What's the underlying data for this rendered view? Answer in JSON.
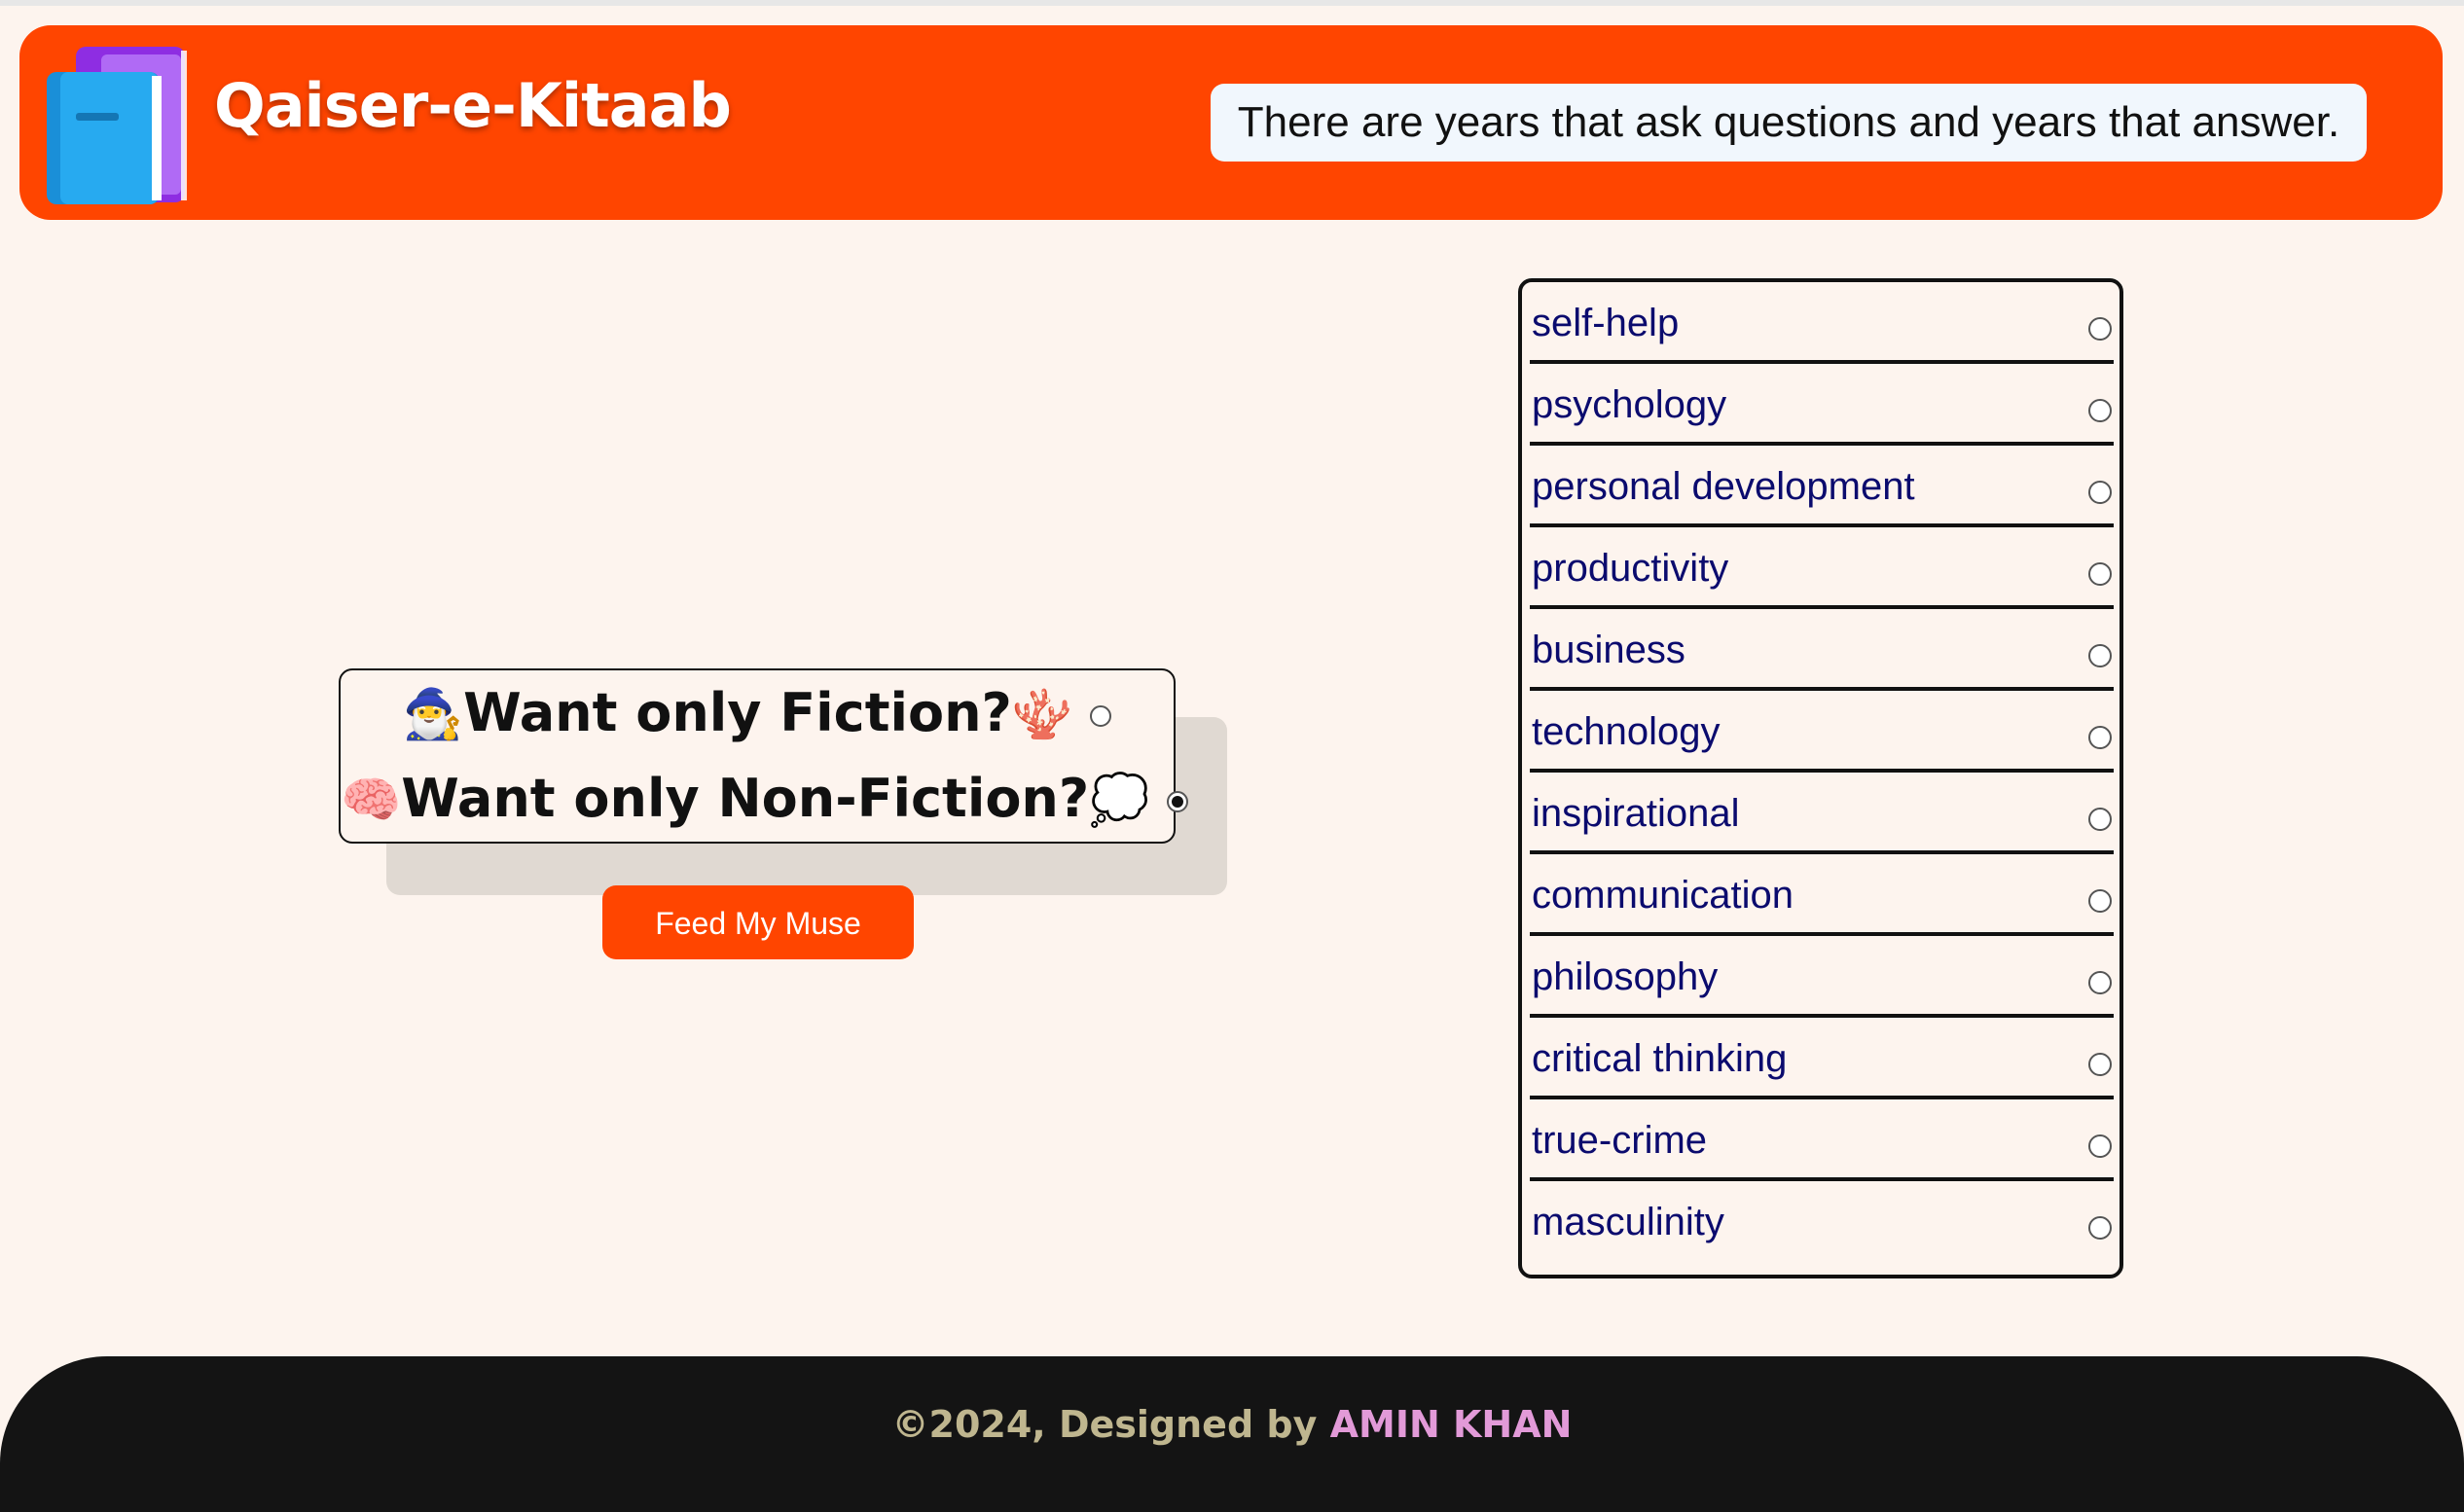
{
  "header": {
    "brand": "Qaiser-e-Kitaab",
    "logo_icon": "books-icon",
    "quote": "There are years that ask questions and years that answer."
  },
  "choice": {
    "fiction_emoji_left": "🧙‍♂️",
    "fiction_label": "Want only Fiction?",
    "fiction_emoji_right": "🪸",
    "fiction_selected": false,
    "nonfiction_emoji_left": "🧠",
    "nonfiction_label": "Want only Non-Fiction?",
    "nonfiction_emoji_right": "💭",
    "nonfiction_selected": true
  },
  "feed_button": "Feed My Muse",
  "genres": [
    {
      "label": "self-help"
    },
    {
      "label": "psychology"
    },
    {
      "label": "personal development"
    },
    {
      "label": "productivity"
    },
    {
      "label": "business"
    },
    {
      "label": "technology"
    },
    {
      "label": "inspirational"
    },
    {
      "label": "communication"
    },
    {
      "label": "philosophy"
    },
    {
      "label": "critical thinking"
    },
    {
      "label": "true-crime"
    },
    {
      "label": "masculinity"
    }
  ],
  "footer": {
    "prefix": "©2024, Designed by ",
    "author": "AMIN KHAN"
  },
  "colors": {
    "accent": "#ff4500",
    "background": "#fdf4ee",
    "genre_text": "#0b0b6e",
    "footer_bg": "#141414",
    "footer_author": "#e29ad8"
  }
}
